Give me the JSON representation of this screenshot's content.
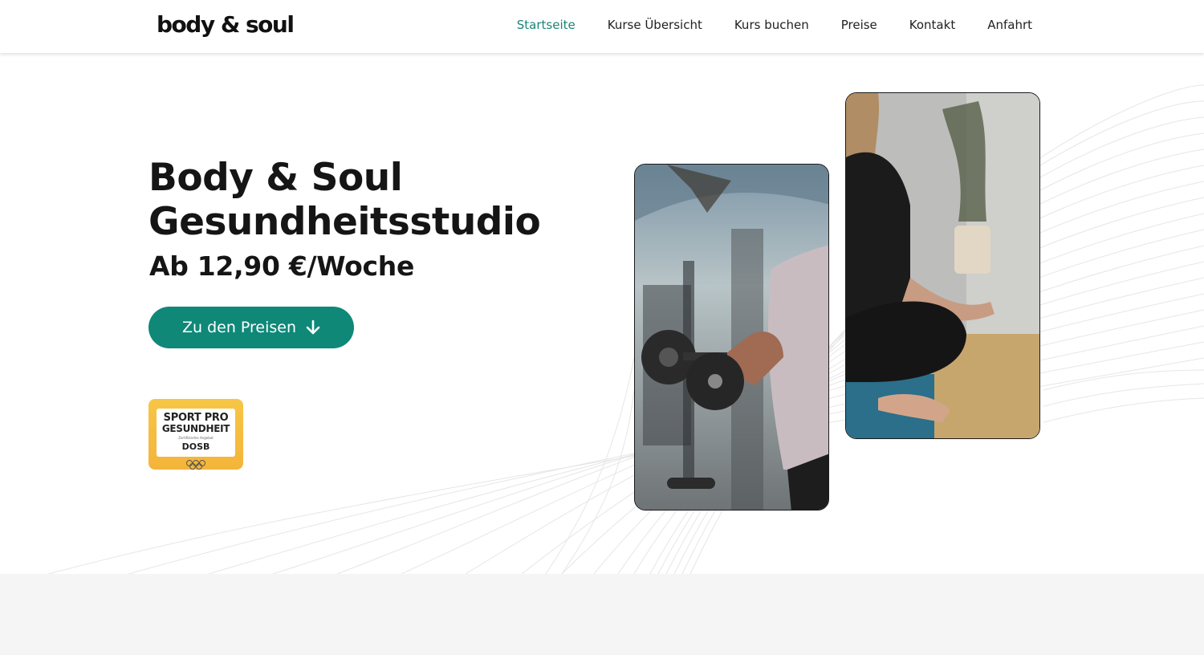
{
  "header": {
    "logo": "body & soul",
    "nav": [
      {
        "label": "Startseite",
        "active": true
      },
      {
        "label": "Kurse Übersicht",
        "active": false
      },
      {
        "label": "Kurs buchen",
        "active": false
      },
      {
        "label": "Preise",
        "active": false
      },
      {
        "label": "Kontakt",
        "active": false
      },
      {
        "label": "Anfahrt",
        "active": false
      }
    ]
  },
  "hero": {
    "title_line1": "Body & Soul",
    "title_line2": "Gesundheitsstudio",
    "subtitle": "Ab 12,90 €/Woche",
    "cta_label": "Zu den Preisen",
    "cta_icon": "arrow-down-icon",
    "badge": {
      "line1": "SPORT PRO",
      "line2": "GESUNDHEIT",
      "small": "Zertifiziertes Angebot",
      "org": "DOSB"
    }
  },
  "colors": {
    "accent": "#0f8878",
    "nav_active": "#1a8577",
    "badge": "#f4b43a",
    "band": "#f5f5f5"
  }
}
